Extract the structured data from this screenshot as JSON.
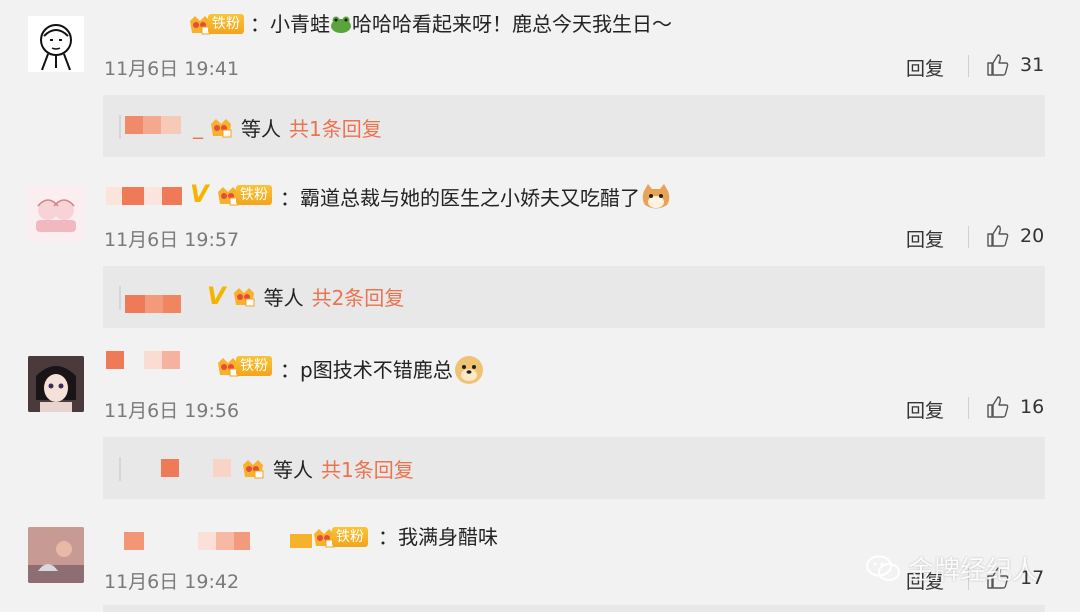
{
  "colors": {
    "accent_orange": "#eb7350",
    "fan_gold": "#f5b22a",
    "background": "#f2f2f2",
    "reply_box": "#e8e8e8"
  },
  "comments": [
    {
      "fan_badge": "铁粉",
      "text": "：小青蛙",
      "text_after_emoji": "哈哈哈看起来呀！鹿总今天我生日～",
      "emoji": "frog-emoji",
      "time": "11月6日 19:41",
      "reply_label": "回复",
      "likes": "31",
      "reply_summary": {
        "prefix": "_",
        "people": "等人",
        "count_text": "共1条回复"
      }
    },
    {
      "fan_badge": "铁粉",
      "text": "：霸道总裁与她的医生之小娇夫又吃醋了",
      "emoji": "cat-emoji",
      "time": "11月6日 19:57",
      "reply_label": "回复",
      "likes": "20",
      "reply_summary": {
        "people": "等人",
        "count_text": "共2条回复"
      }
    },
    {
      "fan_badge": "铁粉",
      "text": "：p图技术不错鹿总",
      "emoji": "doge-emoji",
      "time": "11月6日 19:56",
      "reply_label": "回复",
      "likes": "16",
      "reply_summary": {
        "people": "等人",
        "count_text": "共1条回复"
      }
    },
    {
      "fan_badge": "铁粉",
      "text": "：我满身醋味",
      "time": "11月6日 19:42",
      "reply_label": "回复",
      "likes": "17"
    }
  ],
  "watermark": {
    "icon": "wechat-icon",
    "text": "金牌经纪人"
  }
}
